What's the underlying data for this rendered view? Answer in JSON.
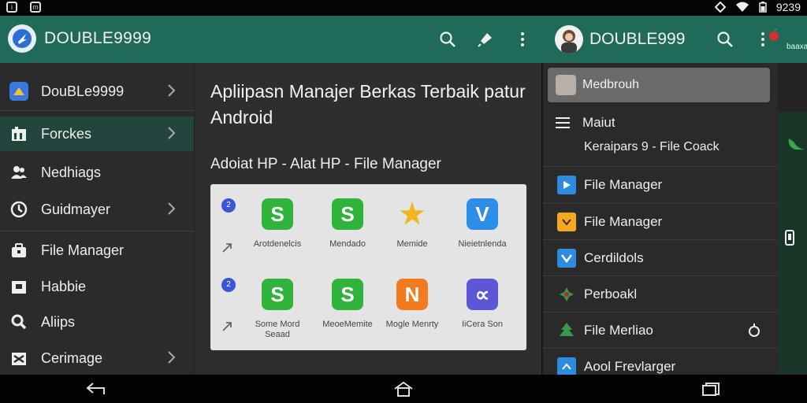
{
  "statusbar": {
    "time": "9239"
  },
  "appbar": {
    "title": "DOUBLE9999"
  },
  "appbar2": {
    "title": "DOUBLE999",
    "subtitle": "baaxa"
  },
  "sidebar": {
    "items": [
      {
        "label": "DouBLe9999",
        "icon": "app-logo-icon",
        "chevron": true
      },
      {
        "label": "Forckes",
        "icon": "chart-icon",
        "chevron": true,
        "active": true
      },
      {
        "label": "Nedhiags",
        "icon": "people-icon",
        "chevron": false
      },
      {
        "label": "Guidmayer",
        "icon": "clock-icon",
        "chevron": true
      },
      {
        "label": "File Manager",
        "icon": "briefcase-icon",
        "chevron": false
      },
      {
        "label": "Habbie",
        "icon": "box-icon",
        "chevron": false
      },
      {
        "label": "Aliips",
        "icon": "search-icon",
        "chevron": false
      },
      {
        "label": "Cerimage",
        "icon": "image-icon",
        "chevron": true
      }
    ]
  },
  "main": {
    "title": "Apliipasn Manajer Berkas Terbaik patur Android",
    "subtitle": "Adoiat HP - Alat HP - File Manager",
    "card": {
      "badge": "2",
      "apps": [
        {
          "label": "Arotdenelcis",
          "glyph": "S",
          "color": "#2fb33a"
        },
        {
          "label": "Mendado",
          "glyph": "S",
          "color": "#2fb33a"
        },
        {
          "label": "Memide",
          "glyph": "★",
          "color": "#f3b51f"
        },
        {
          "label": "Nieietnlenda",
          "glyph": "V",
          "color": "#2d8ee8"
        },
        {
          "label": "Some Mord Seaad",
          "glyph": "S",
          "color": "#2fb33a"
        },
        {
          "label": "MeoeMemite",
          "glyph": "S",
          "color": "#2fb33a"
        },
        {
          "label": "Mogle Menrty",
          "glyph": "N",
          "color": "#f27b1f"
        },
        {
          "label": "IiCera Son",
          "glyph": "∝",
          "color": "#5b57d6"
        }
      ]
    }
  },
  "drawer": {
    "header": "Medbrouh",
    "menu_label": "Maiut",
    "menu_sub": "Keraipars 9 - File Coack",
    "items": [
      {
        "label": "File Manager",
        "icon": "play-icon",
        "color": "#2b8ce0"
      },
      {
        "label": "File Manager",
        "icon": "folder-icon",
        "color": "#f4a81f"
      },
      {
        "label": "Cerdildols",
        "icon": "check-icon",
        "color": "#2b8ce0"
      },
      {
        "label": "Perboakl",
        "icon": "leaf-icon",
        "color": "#3a9a4a"
      },
      {
        "label": "File Merliao",
        "icon": "tree-icon",
        "color": "#3a9a4a"
      },
      {
        "label": "Aool Frevlarger",
        "icon": "doc-icon",
        "color": "#2b8ce0"
      }
    ]
  }
}
